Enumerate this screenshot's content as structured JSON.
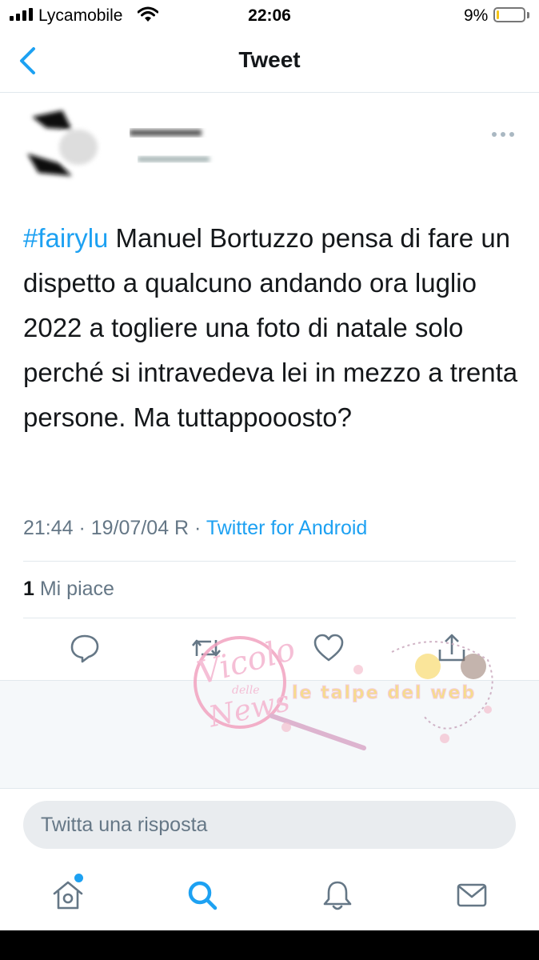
{
  "status_bar": {
    "carrier": "Lycamobile",
    "time": "22:06",
    "battery_percent": "9%",
    "battery_level": 0.09
  },
  "nav": {
    "title": "Tweet"
  },
  "tweet": {
    "hashtag": "#fairylu",
    "text": " Manuel Bortuzzo pensa di fare un dispetto a qualcuno andando ora luglio 2022 a togliere una foto di natale solo perché si intravedeva lei in mezzo a trenta persone. Ma tuttappooosto?",
    "timestamp": "21:44 · 19/07/04 R · ",
    "source": "Twitter for Android",
    "likes_count": "1",
    "likes_label": " Mi piace"
  },
  "reply": {
    "placeholder": "Twitta una risposta"
  },
  "watermark": {
    "left_logo": "Vicolo delle News",
    "right_logo": "le talpe del web"
  },
  "icons": {
    "back": "chevron-left-icon",
    "more": "more-horizontal-icon",
    "reply": "comment-icon",
    "retweet": "retweet-icon",
    "like": "heart-icon",
    "share": "share-icon",
    "home": "home-icon",
    "search": "search-icon",
    "notifications": "bell-icon",
    "messages": "mail-icon"
  },
  "colors": {
    "accent": "#1da1f2",
    "secondary_text": "#657786",
    "primary_text": "#14171a",
    "battery": "#f5c518"
  }
}
